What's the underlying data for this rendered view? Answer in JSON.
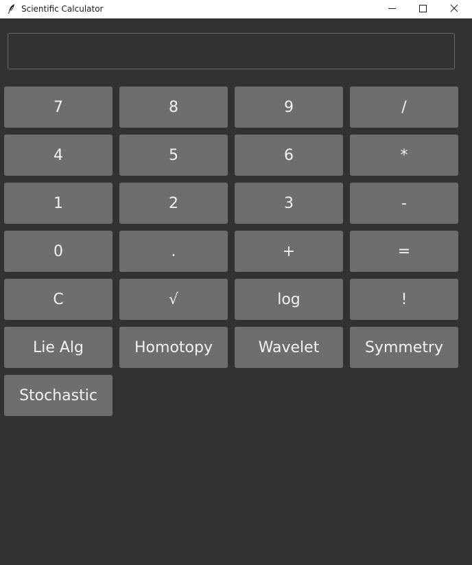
{
  "window": {
    "title": "Scientific Calculator",
    "controls": [
      "minimize",
      "maximize",
      "close"
    ]
  },
  "display": {
    "value": "",
    "placeholder": ""
  },
  "keypad": {
    "rows": [
      [
        "7",
        "8",
        "9",
        "/"
      ],
      [
        "4",
        "5",
        "6",
        "*"
      ],
      [
        "1",
        "2",
        "3",
        "-"
      ],
      [
        "0",
        ".",
        "+",
        "="
      ],
      [
        "C",
        "√",
        "log",
        "!"
      ],
      [
        "Lie Alg",
        "Homotopy",
        "Wavelet",
        "Symmetry"
      ],
      [
        "Stochastic"
      ]
    ]
  },
  "colors": {
    "background": "#323232",
    "button": "#6e6e6e",
    "button_text": "#f2f2f2",
    "titlebar": "#ffffff"
  }
}
